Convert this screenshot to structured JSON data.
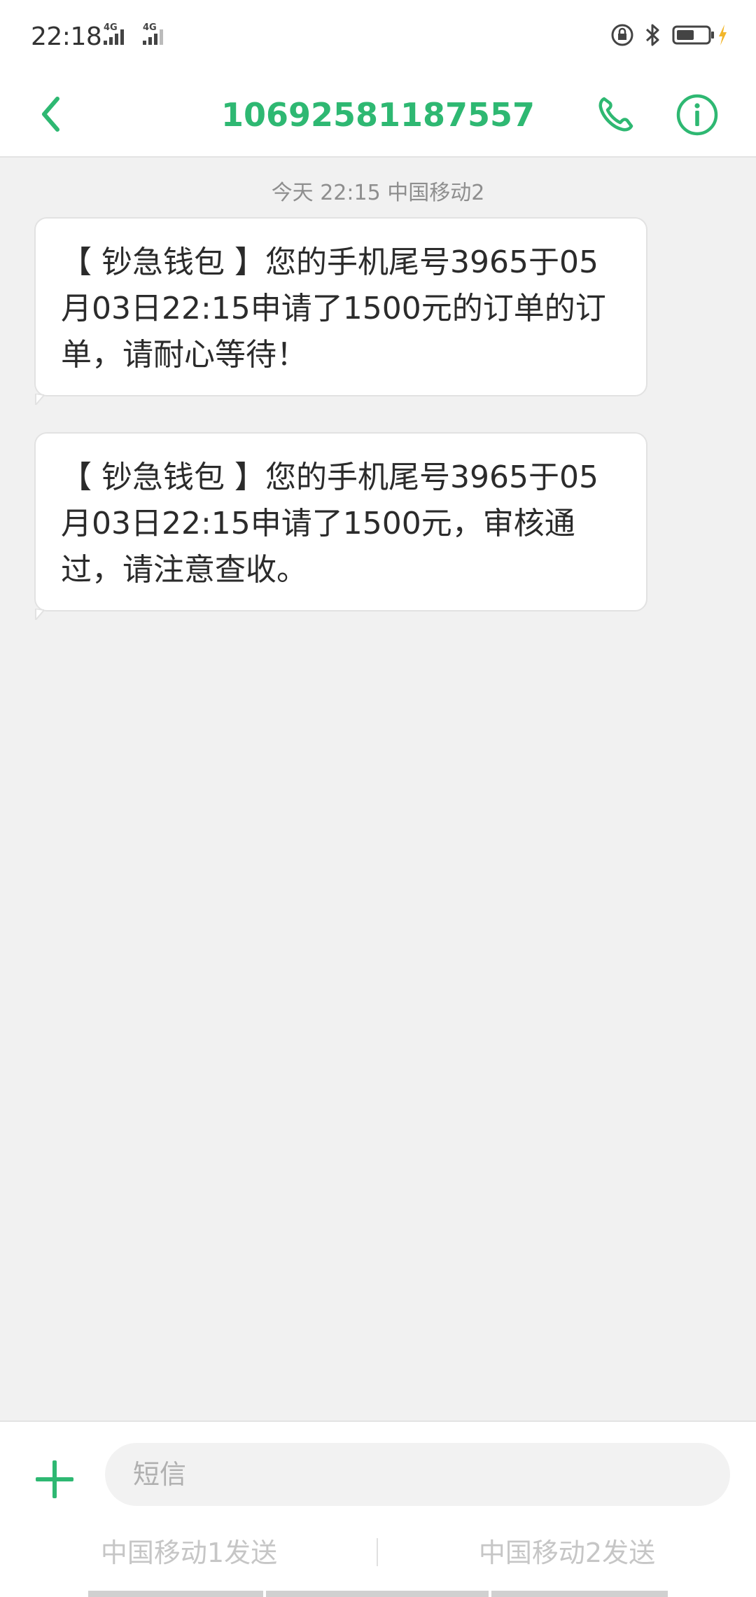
{
  "status_bar": {
    "time": "22:18",
    "sim1_network": "4G",
    "sim2_network": "4G",
    "icons": [
      "rotation-lock-icon",
      "bluetooth-icon",
      "battery-icon",
      "charging-icon"
    ]
  },
  "header": {
    "title": "10692581187557",
    "back_icon": "chevron-left-icon",
    "call_icon": "phone-icon",
    "info_icon": "info-icon",
    "accent_color": "#2eb872"
  },
  "conversation": {
    "timestamp": "今天 22:15  中国移动2",
    "messages": [
      {
        "text": "【 钞急钱包 】您的手机尾号3965于05月03日22:15申请了1500元的订单的订单，请耐心等待！"
      },
      {
        "text": "【 钞急钱包 】您的手机尾号3965于05月03日22:15申请了1500元，审核通过，请注意查收。"
      }
    ]
  },
  "composer": {
    "add_icon": "plus-icon",
    "placeholder": "短信",
    "value": "",
    "send_sim1_label": "中国移动1发送",
    "send_sim2_label": "中国移动2发送"
  }
}
